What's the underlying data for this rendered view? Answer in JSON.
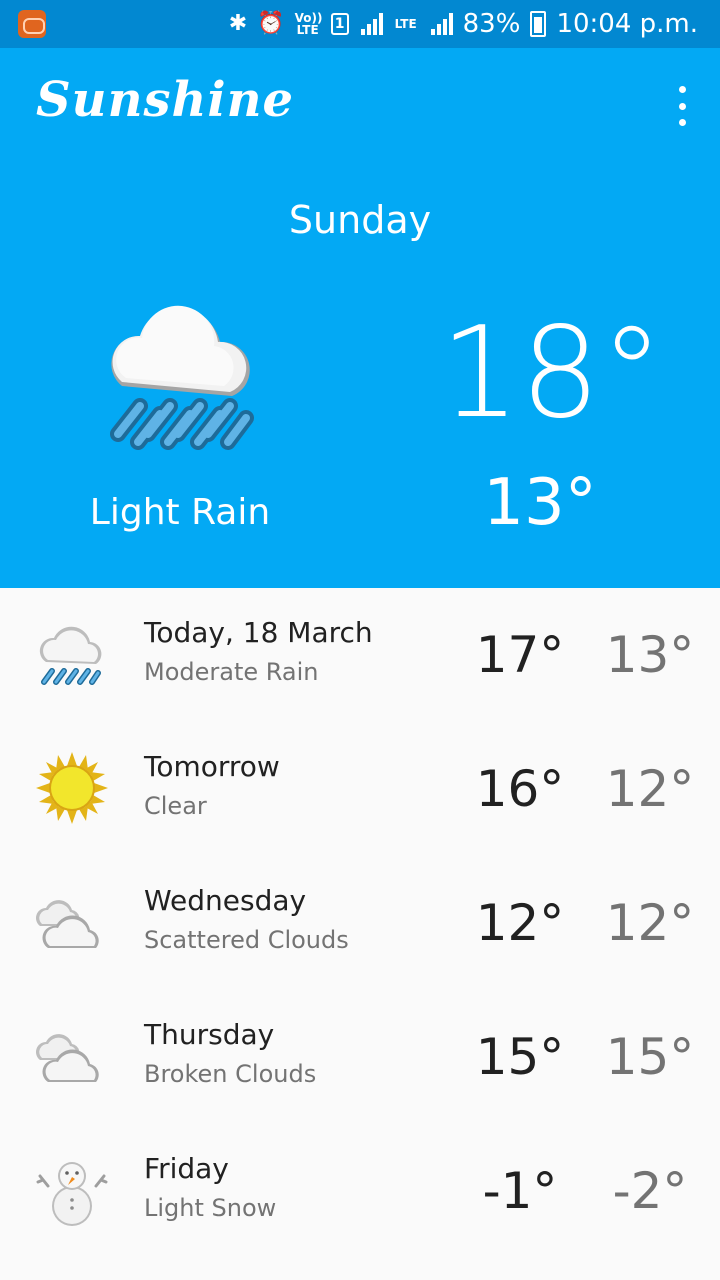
{
  "status_bar": {
    "battery": "83%",
    "time": "10:04 p.m.",
    "volte_label": "Vo)) LTE",
    "lte_label": "LTE",
    "sim_label": "1"
  },
  "app_bar": {
    "title": "Sunshine",
    "menu_icon": "overflow-menu-icon"
  },
  "today": {
    "day": "Sunday",
    "high": "18°",
    "low": "13°",
    "condition": "Light Rain",
    "icon": "light-rain-icon"
  },
  "forecast": [
    {
      "day": "Today, 18 March",
      "desc": "Moderate Rain",
      "high": "17°",
      "low": "13°",
      "icon": "rain-icon"
    },
    {
      "day": "Tomorrow",
      "desc": "Clear",
      "high": "16°",
      "low": "12°",
      "icon": "sun-icon"
    },
    {
      "day": "Wednesday",
      "desc": "Scattered Clouds",
      "high": "12°",
      "low": "12°",
      "icon": "clouds-icon"
    },
    {
      "day": "Thursday",
      "desc": "Broken Clouds",
      "high": "15°",
      "low": "15°",
      "icon": "clouds-icon"
    },
    {
      "day": "Friday",
      "desc": "Light Snow",
      "high": "-1°",
      "low": "-2°",
      "icon": "snowman-icon"
    }
  ],
  "colors": {
    "primary": "#03a9f4",
    "primary_dark": "#0288d1",
    "background": "#fafafa",
    "text_primary": "#212121",
    "text_secondary": "#737373"
  }
}
